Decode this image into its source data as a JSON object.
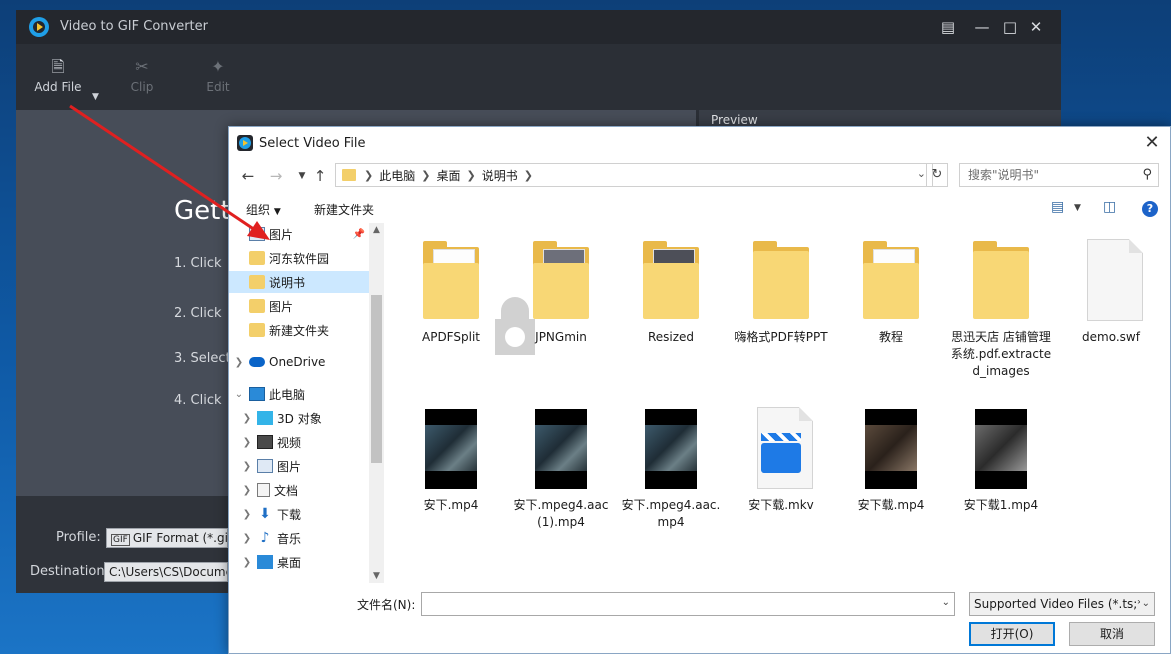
{
  "app": {
    "title": "Video to GIF Converter",
    "toolbar": {
      "add_file": "Add File",
      "clip": "Clip",
      "edit": "Edit"
    },
    "main": {
      "heading": "Getti",
      "steps": [
        "1. Click",
        "2. Click",
        "3. Select",
        "4. Click"
      ]
    },
    "preview_label": "Preview",
    "profile_label": "Profile:",
    "profile_value": "GIF Format (*.gi",
    "destination_label": "Destination:",
    "destination_value": "C:\\Users\\CS\\Docume"
  },
  "dialog": {
    "title": "Select Video File",
    "breadcrumb": [
      "此电脑",
      "桌面",
      "说明书"
    ],
    "search_placeholder": "搜索\"说明书\"",
    "cmd_organize": "组织",
    "cmd_new_folder": "新建文件夹",
    "tree": [
      {
        "label": "图片",
        "type": "pictures",
        "pinned": true
      },
      {
        "label": "河东软件园",
        "type": "folder"
      },
      {
        "label": "说明书",
        "type": "folder",
        "selected": true
      },
      {
        "label": "图片",
        "type": "folder"
      },
      {
        "label": "新建文件夹",
        "type": "folder"
      },
      {
        "label": "OneDrive",
        "type": "onedrive"
      },
      {
        "label": "此电脑",
        "type": "pc"
      },
      {
        "label": "3D 对象",
        "type": "3d"
      },
      {
        "label": "视频",
        "type": "video"
      },
      {
        "label": "图片",
        "type": "pictures"
      },
      {
        "label": "文档",
        "type": "docs"
      },
      {
        "label": "下载",
        "type": "download"
      },
      {
        "label": "音乐",
        "type": "music"
      },
      {
        "label": "桌面",
        "type": "desktop"
      }
    ],
    "files_row1": [
      "APDFSplit",
      "JPNGmin",
      "Resized",
      "嗨格式PDF转PPT",
      "教程",
      "思迅天店 店铺管理系统.pdf.extracted_images",
      "demo.swf"
    ],
    "files_row2": [
      "安下.mp4",
      "安下.mpeg4.aac(1).mp4",
      "安下.mpeg4.aac.mp4",
      "安下载.mkv",
      "安下载.mp4",
      "安下载1.mp4"
    ],
    "filename_label": "文件名(N):",
    "filename_value": "",
    "filetype": "Supported Video Files (*.ts;*",
    "open_button": "打开(O)",
    "cancel_button": "取消"
  },
  "colors": {
    "accent": "#0078d7",
    "selection": "#cce8ff",
    "annotation_arrow": "#e02020"
  }
}
